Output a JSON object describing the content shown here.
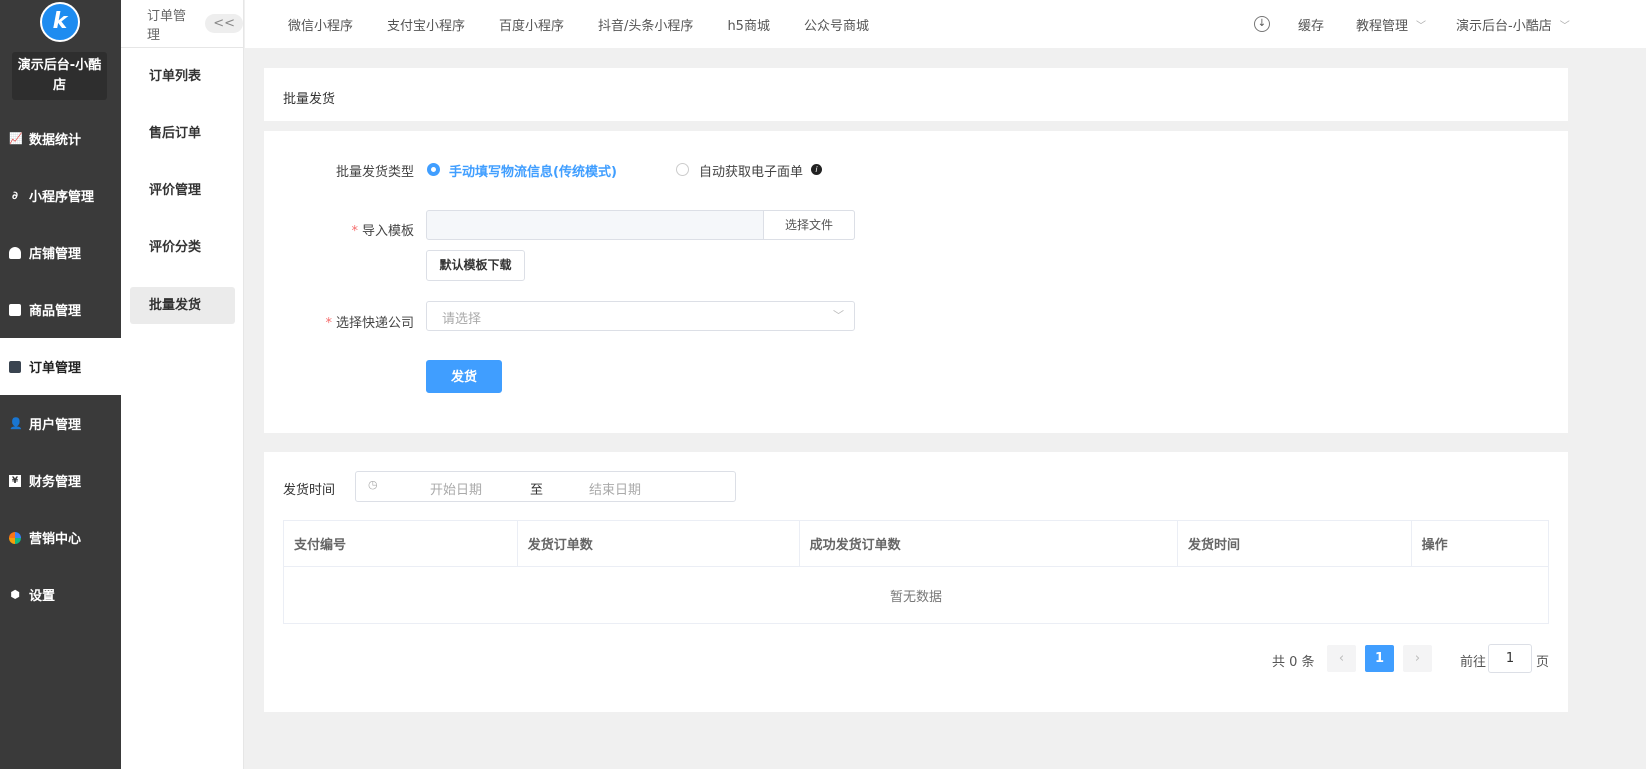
{
  "brand": {
    "logo_letter": "k",
    "shop_name": "演示后台-小酷店"
  },
  "sidebar": {
    "items": [
      {
        "label": "数据统计",
        "icon": "chart-icon"
      },
      {
        "label": "小程序管理",
        "icon": "link-icon"
      },
      {
        "label": "店铺管理",
        "icon": "store-icon"
      },
      {
        "label": "商品管理",
        "icon": "bag-icon"
      },
      {
        "label": "订单管理",
        "icon": "clipboard-icon",
        "active": true
      },
      {
        "label": "用户管理",
        "icon": "user-icon"
      },
      {
        "label": "财务管理",
        "icon": "finance-icon"
      },
      {
        "label": "营销中心",
        "icon": "marketing-icon"
      },
      {
        "label": "设置",
        "icon": "gear-icon"
      }
    ]
  },
  "subnav": {
    "title": "订单管理",
    "collapse": "<<",
    "items": [
      "订单列表",
      "售后订单",
      "评价管理",
      "评价分类",
      "批量发货"
    ],
    "active": 4
  },
  "topbar": {
    "tabs": [
      "微信小程序",
      "支付宝小程序",
      "百度小程序",
      "抖音/头条小程序",
      "h5商城",
      "公众号商城"
    ],
    "cache": "缓存",
    "tutorial": "教程管理",
    "account": "演示后台-小酷店"
  },
  "page": {
    "title": "批量发货"
  },
  "form": {
    "type_label": "批量发货类型",
    "type_options": [
      "手动填写物流信息(传统模式)",
      "自动获取电子面单"
    ],
    "selected_type": 0,
    "template_label": "导入模板",
    "choose_file": "选择文件",
    "download_template": "默认模板下载",
    "courier_label": "选择快递公司",
    "courier_placeholder": "请选择",
    "submit": "发货"
  },
  "filter": {
    "label": "发货时间",
    "start_placeholder": "开始日期",
    "separator": "至",
    "end_placeholder": "结束日期"
  },
  "table": {
    "columns": [
      "支付编号",
      "发货订单数",
      "成功发货订单数",
      "发货时间",
      "操作"
    ],
    "empty": "暂无数据"
  },
  "pagination": {
    "total": "共 0 条",
    "current": "1",
    "goto_label": "前往",
    "goto_value": "1",
    "page_suffix": "页"
  },
  "colors": {
    "primary": "#409eff",
    "sidebar": "#3a3a3a"
  }
}
